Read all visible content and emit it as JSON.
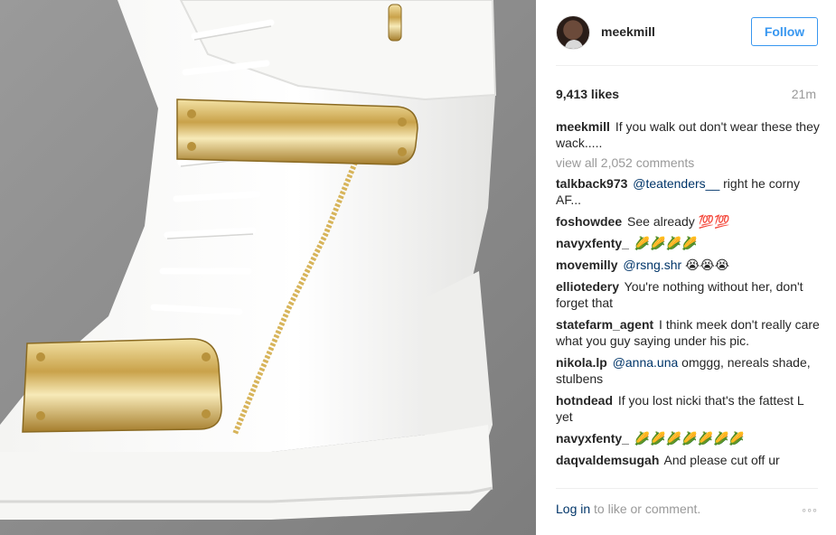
{
  "post": {
    "photo_alt": "White sneaker with gold straps",
    "username": "meekmill",
    "follow_label": "Follow",
    "likes": "9,413 likes",
    "time": "21m",
    "caption_text": "If you walk out don't wear these they wack.....",
    "view_all": "view all 2,052 comments",
    "login_link": "Log in",
    "login_rest": " to like or comment.",
    "more_label": "◦◦◦"
  },
  "comments": [
    {
      "author": "talkback973",
      "mention": "@teatenders__",
      "text": " right he corny AF..."
    },
    {
      "author": "foshowdee",
      "mention": "",
      "text": "See already 💯💯"
    },
    {
      "author": "navyxfenty_",
      "mention": "",
      "text": "🌽🌽🌽🌽"
    },
    {
      "author": "movemilly",
      "mention": "@rsng.shr",
      "text": " 😭😭😭"
    },
    {
      "author": "elliotedery",
      "mention": "",
      "text": "You're nothing without her, don't forget that"
    },
    {
      "author": "statefarm_agent",
      "mention": "",
      "text": "I think meek don't really care what you guy saying under his pic."
    },
    {
      "author": "nikola.lp",
      "mention": "@anna.una",
      "text": " omggg, nereals shade, stulbens"
    },
    {
      "author": "hotndead",
      "mention": "",
      "text": "If you lost nicki that's the fattest L yet"
    },
    {
      "author": "navyxfenty_",
      "mention": "",
      "text": "🌽🌽🌽🌽🌽🌽🌽"
    },
    {
      "author": "daqvaldemsugah",
      "mention": "",
      "text": "And please cut off ur"
    }
  ]
}
